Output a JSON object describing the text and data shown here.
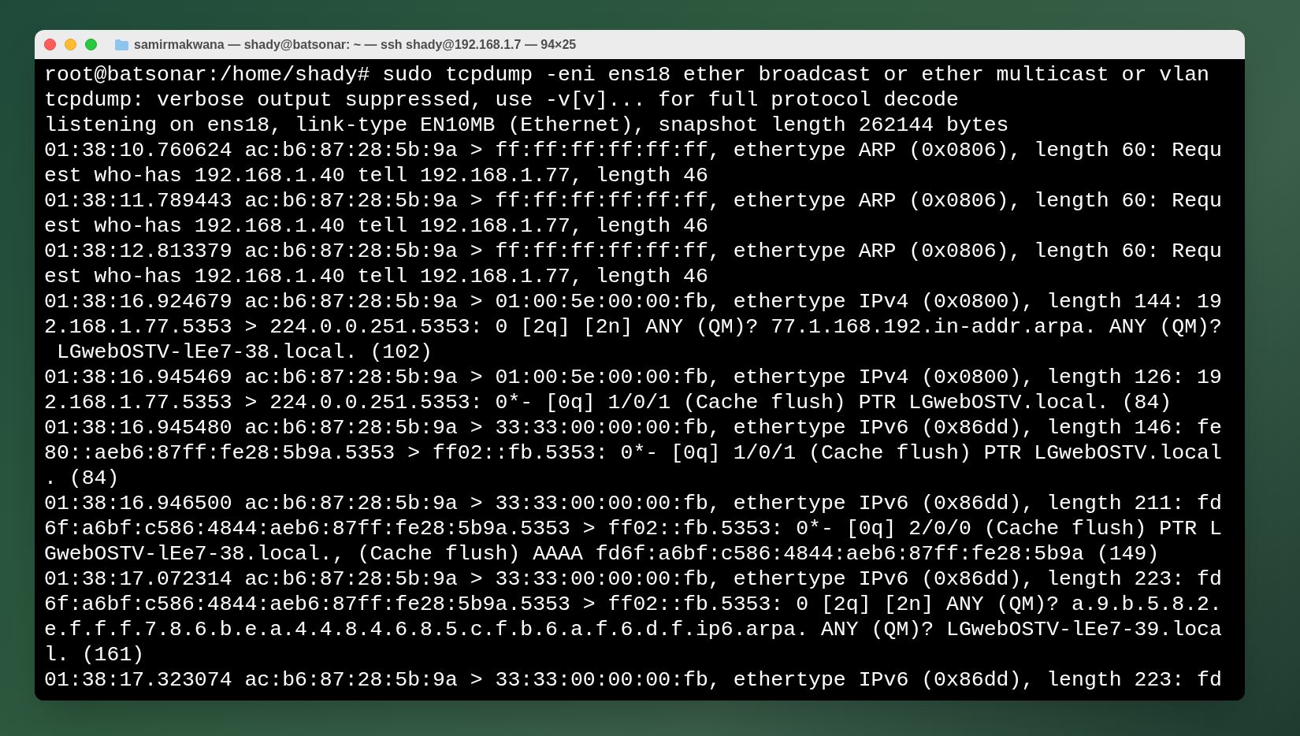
{
  "window": {
    "title": "samirmakwana — shady@batsonar: ~ — ssh shady@192.168.1.7 — 94×25"
  },
  "terminal": {
    "lines": [
      "root@batsonar:/home/shady# sudo tcpdump -eni ens18 ether broadcast or ether multicast or vlan",
      "tcpdump: verbose output suppressed, use -v[v]... for full protocol decode",
      "listening on ens18, link-type EN10MB (Ethernet), snapshot length 262144 bytes",
      "01:38:10.760624 ac:b6:87:28:5b:9a > ff:ff:ff:ff:ff:ff, ethertype ARP (0x0806), length 60: Requ",
      "est who-has 192.168.1.40 tell 192.168.1.77, length 46",
      "01:38:11.789443 ac:b6:87:28:5b:9a > ff:ff:ff:ff:ff:ff, ethertype ARP (0x0806), length 60: Requ",
      "est who-has 192.168.1.40 tell 192.168.1.77, length 46",
      "01:38:12.813379 ac:b6:87:28:5b:9a > ff:ff:ff:ff:ff:ff, ethertype ARP (0x0806), length 60: Requ",
      "est who-has 192.168.1.40 tell 192.168.1.77, length 46",
      "01:38:16.924679 ac:b6:87:28:5b:9a > 01:00:5e:00:00:fb, ethertype IPv4 (0x0800), length 144: 19",
      "2.168.1.77.5353 > 224.0.0.251.5353: 0 [2q] [2n] ANY (QM)? 77.1.168.192.in-addr.arpa. ANY (QM)?",
      " LGwebOSTV-lEe7-38.local. (102)",
      "01:38:16.945469 ac:b6:87:28:5b:9a > 01:00:5e:00:00:fb, ethertype IPv4 (0x0800), length 126: 19",
      "2.168.1.77.5353 > 224.0.0.251.5353: 0*- [0q] 1/0/1 (Cache flush) PTR LGwebOSTV.local. (84)",
      "01:38:16.945480 ac:b6:87:28:5b:9a > 33:33:00:00:00:fb, ethertype IPv6 (0x86dd), length 146: fe",
      "80::aeb6:87ff:fe28:5b9a.5353 > ff02::fb.5353: 0*- [0q] 1/0/1 (Cache flush) PTR LGwebOSTV.local",
      ". (84)",
      "01:38:16.946500 ac:b6:87:28:5b:9a > 33:33:00:00:00:fb, ethertype IPv6 (0x86dd), length 211: fd",
      "6f:a6bf:c586:4844:aeb6:87ff:fe28:5b9a.5353 > ff02::fb.5353: 0*- [0q] 2/0/0 (Cache flush) PTR L",
      "GwebOSTV-lEe7-38.local., (Cache flush) AAAA fd6f:a6bf:c586:4844:aeb6:87ff:fe28:5b9a (149)",
      "01:38:17.072314 ac:b6:87:28:5b:9a > 33:33:00:00:00:fb, ethertype IPv6 (0x86dd), length 223: fd",
      "6f:a6bf:c586:4844:aeb6:87ff:fe28:5b9a.5353 > ff02::fb.5353: 0 [2q] [2n] ANY (QM)? a.9.b.5.8.2.",
      "e.f.f.f.7.8.6.b.e.a.4.4.8.4.6.8.5.c.f.b.6.a.f.6.d.f.ip6.arpa. ANY (QM)? LGwebOSTV-lEe7-39.loca",
      "l. (161)",
      "01:38:17.323074 ac:b6:87:28:5b:9a > 33:33:00:00:00:fb, ethertype IPv6 (0x86dd), length 223: fd"
    ]
  }
}
